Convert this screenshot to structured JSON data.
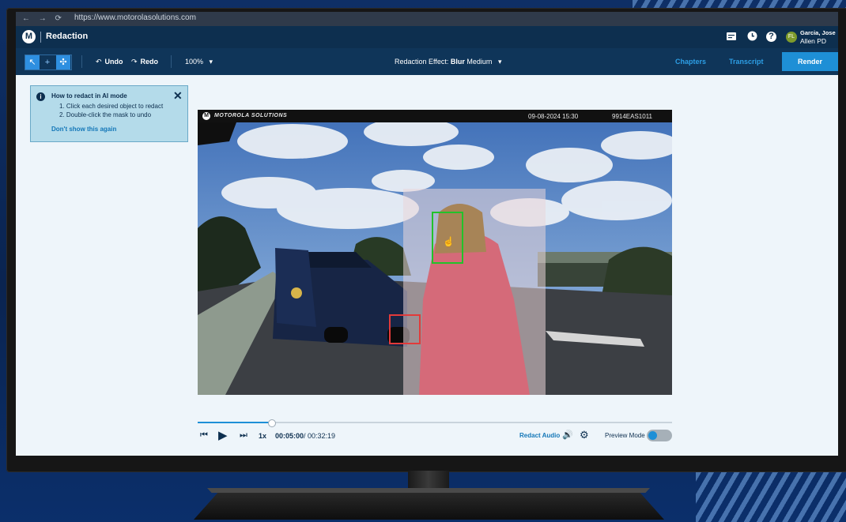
{
  "browser": {
    "nav_arrows": "← → ⟳",
    "url": "https://www.motorolasolutions.com"
  },
  "app": {
    "title": "Redaction",
    "logo_glyph": "M"
  },
  "header": {
    "icons": [
      "subtitles-icon",
      "history-icon",
      "help-icon"
    ],
    "help_glyph": "?",
    "avatar_initials": "FL",
    "user_name": "Garcia, Jose",
    "user_org": "Allen PD"
  },
  "toolbar": {
    "tools": [
      {
        "name": "select-tool",
        "glyph": "↖",
        "active": true
      },
      {
        "name": "add-tool",
        "glyph": "+",
        "active": false
      },
      {
        "name": "ai-tool",
        "glyph": "✣",
        "active": true
      }
    ],
    "undo_icon": "↶",
    "undo_label": "Undo",
    "redo_icon": "↷",
    "redo_label": "Redo",
    "zoom": "100%",
    "zoom_caret": "▾",
    "effect_prefix": "Redaction Effect:",
    "effect_value": "Blur",
    "effect_strength": "Medium",
    "chapters_label": "Chapters",
    "transcript_label": "Transcript",
    "render_label": "Render"
  },
  "tip": {
    "title": "How to redact in AI mode",
    "steps": [
      "1. Click each desired object to redact",
      "2. Double-click the mask to undo"
    ],
    "dismiss_label": "Don't show this again",
    "close_glyph": "✕",
    "info_glyph": "i"
  },
  "video": {
    "brand": "MOTOROLA SOLUTIONS",
    "date": "09-08-2024 15:30",
    "device_id": "9914EAS1011",
    "masks": [
      {
        "name": "face-mask",
        "color": "#22c22a"
      },
      {
        "name": "plate-mask",
        "color": "#e23a3a"
      }
    ]
  },
  "player": {
    "progress_fraction": 0.155,
    "prev_glyph": "⏮",
    "play_glyph": "▶",
    "next_glyph": "⏭",
    "speed": "1x",
    "current_time": "00:05:00",
    "total_time": "/ 00:32:19",
    "redact_audio_label": "Redact Audio",
    "volume_glyph": "🔊",
    "settings_glyph": "⚙",
    "preview_mode_label": "Preview Mode",
    "preview_mode_on": true
  },
  "colors": {
    "header": "#0d2f4f",
    "accent": "#1e8fd6",
    "tip_bg": "#b4dbea"
  }
}
